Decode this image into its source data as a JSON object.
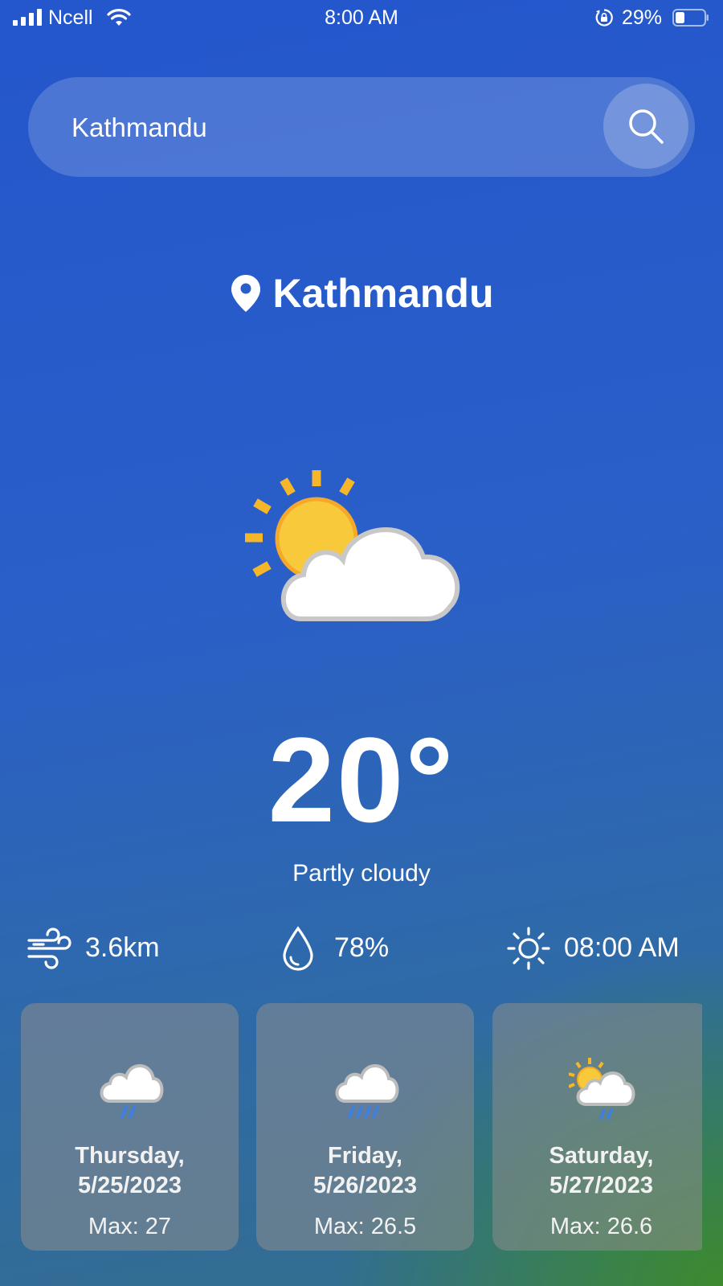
{
  "status_bar": {
    "carrier": "Ncell",
    "time": "8:00 AM",
    "battery": "29%"
  },
  "search": {
    "value": "Kathmandu",
    "placeholder": ""
  },
  "location": {
    "name": "Kathmandu"
  },
  "current": {
    "icon": "partly-cloudy-icon",
    "temperature": "20°",
    "condition": "Partly cloudy"
  },
  "metrics": {
    "wind": "3.6km",
    "humidity": "78%",
    "sunrise": "08:00 AM"
  },
  "forecast": [
    {
      "day": "Thursday,",
      "date": "5/25/2023",
      "max": "Max: 27",
      "icon": "rain-cloud-icon"
    },
    {
      "day": "Friday,",
      "date": "5/26/2023",
      "max": "Max: 26.5",
      "icon": "heavy-rain-cloud-icon"
    },
    {
      "day": "Saturday,",
      "date": "5/27/2023",
      "max": "Max: 26.6",
      "icon": "sun-rain-cloud-icon"
    }
  ],
  "colors": {
    "background_top": "#2456cc",
    "background_corner": "#3c8c28",
    "card": "#8c8c8c",
    "sun": "#f7c830",
    "rain": "#3f7fe0"
  }
}
